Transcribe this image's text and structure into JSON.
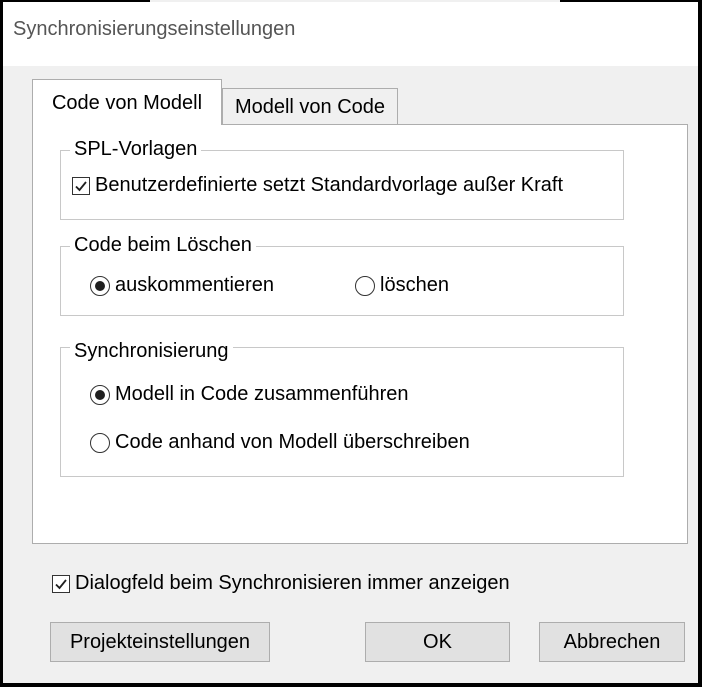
{
  "window": {
    "title": "Synchronisierungseinstellungen"
  },
  "tabs": [
    {
      "label": "Code von Modell",
      "active": true
    },
    {
      "label": "Modell von Code",
      "active": false
    }
  ],
  "spl_group": {
    "legend": "SPL-Vorlagen",
    "checkbox_label": "Benutzerdefinierte setzt Standardvorlage außer Kraft",
    "checked": true
  },
  "delete_group": {
    "legend": "Code beim Löschen",
    "options": [
      {
        "label": "auskommentieren",
        "selected": true
      },
      {
        "label": "löschen",
        "selected": false
      }
    ]
  },
  "sync_group": {
    "legend": "Synchronisierung",
    "options": [
      {
        "label": "Modell in Code zusammenführen",
        "selected": true
      },
      {
        "label": "Code anhand von Modell überschreiben",
        "selected": false
      }
    ]
  },
  "always_show": {
    "label": "Dialogfeld beim Synchronisieren immer anzeigen",
    "checked": true
  },
  "buttons": {
    "project_settings": "Projekteinstellungen",
    "ok": "OK",
    "cancel": "Abbrechen"
  }
}
